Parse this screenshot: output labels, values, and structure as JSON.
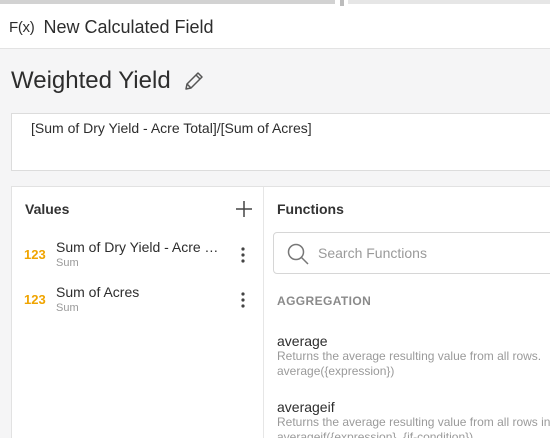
{
  "dialog": {
    "fx_label": "F(x)",
    "title": "New Calculated Field"
  },
  "field": {
    "name": "Weighted Yield",
    "expression": "[Sum of Dry Yield - Acre Total]/[Sum of Acres]"
  },
  "values_panel": {
    "title": "Values",
    "items": [
      {
        "type": "123",
        "name": "Sum of Dry Yield - Acre Total",
        "aggregation": "Sum"
      },
      {
        "type": "123",
        "name": "Sum of Acres",
        "aggregation": "Sum"
      }
    ]
  },
  "functions_panel": {
    "title": "Functions",
    "search_placeholder": "Search Functions",
    "section": "AGGREGATION",
    "functions": [
      {
        "name": "average",
        "description": "Returns the average resulting value from all rows.",
        "syntax": "average({expression})"
      },
      {
        "name": "averageif",
        "description": "Returns the average resulting value from all rows in",
        "syntax": "averageif({expression}, {if-condition})"
      }
    ]
  },
  "icons": {
    "edit": "pencil-icon",
    "add": "plus-icon",
    "more": "kebab-icon",
    "search": "search-icon"
  },
  "colors": {
    "value_type": "#f0a400",
    "section_label": "#8a8a8a"
  }
}
